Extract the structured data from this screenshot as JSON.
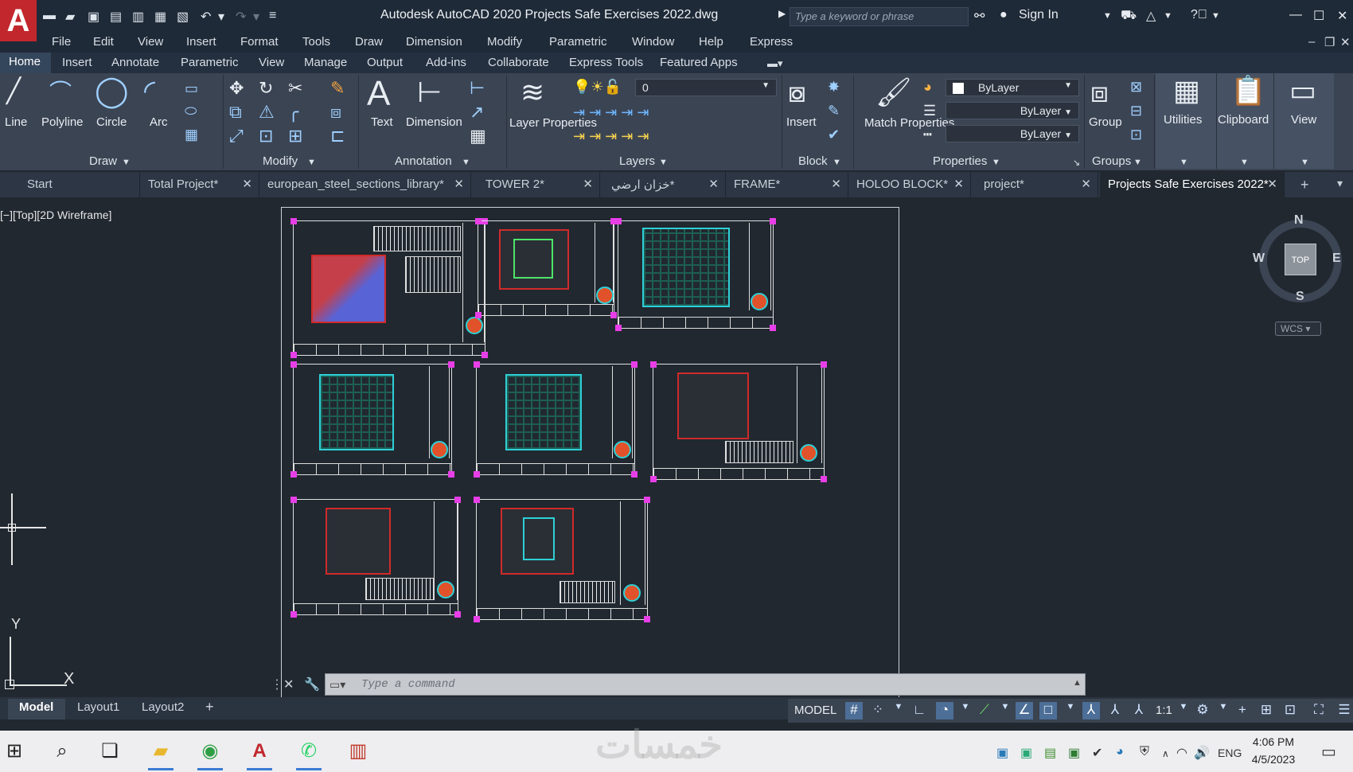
{
  "app": {
    "title": "Autodesk AutoCAD 2020   Projects Safe Exercises 2022.dwg",
    "logo_letter": "A",
    "search_placeholder": "Type a keyword or phrase",
    "sign_in": "Sign In"
  },
  "menu": [
    "File",
    "Edit",
    "View",
    "Insert",
    "Format",
    "Tools",
    "Draw",
    "Dimension",
    "Modify",
    "Parametric",
    "Window",
    "Help",
    "Express"
  ],
  "ribbon_tabs": [
    "Home",
    "Insert",
    "Annotate",
    "Parametric",
    "View",
    "Manage",
    "Output",
    "Add-ins",
    "Collaborate",
    "Express Tools",
    "Featured Apps"
  ],
  "ribbon": {
    "draw": {
      "line": "Line",
      "polyline": "Polyline",
      "circle": "Circle",
      "arc": "Arc",
      "panel": "Draw"
    },
    "modify": {
      "panel": "Modify"
    },
    "annotation": {
      "text": "Text",
      "dimension": "Dimension",
      "panel": "Annotation"
    },
    "layers": {
      "layer_properties": "Layer Properties",
      "current_layer": "0",
      "panel": "Layers"
    },
    "block": {
      "insert": "Insert",
      "panel": "Block"
    },
    "properties": {
      "match": "Match Properties",
      "color": "ByLayer",
      "linetype": "ByLayer",
      "lineweight": "ByLayer",
      "panel": "Properties"
    },
    "groups": {
      "group": "Group",
      "panel": "Groups"
    },
    "utilities": "Utilities",
    "clipboard": "Clipboard",
    "view": "View"
  },
  "doc_tabs": [
    "Start",
    "Total Project*",
    "european_steel_sections_library*",
    "TOWER 2*",
    "خزان ارضي*",
    "FRAME*",
    "HOLOO BLOCK*",
    "project*",
    "Projects Safe Exercises 2022*"
  ],
  "viewport_label": "[−][Top][2D Wireframe]",
  "viewcube": {
    "top": "TOP",
    "n": "N",
    "s": "S",
    "e": "E",
    "w": "W",
    "wcs": "WCS"
  },
  "ucs": {
    "x": "X",
    "y": "Y"
  },
  "command": {
    "placeholder": "Type a command"
  },
  "layout_tabs": [
    "Model",
    "Layout1",
    "Layout2"
  ],
  "status": {
    "model": "MODEL",
    "scale": "1:1"
  },
  "taskbar": {
    "time": "4:06 PM",
    "date": "4/5/2023",
    "lang": "ENG"
  },
  "watermark": "خمسات",
  "colors": {
    "accent": "#4c6e97",
    "logo": "#c1272d"
  }
}
